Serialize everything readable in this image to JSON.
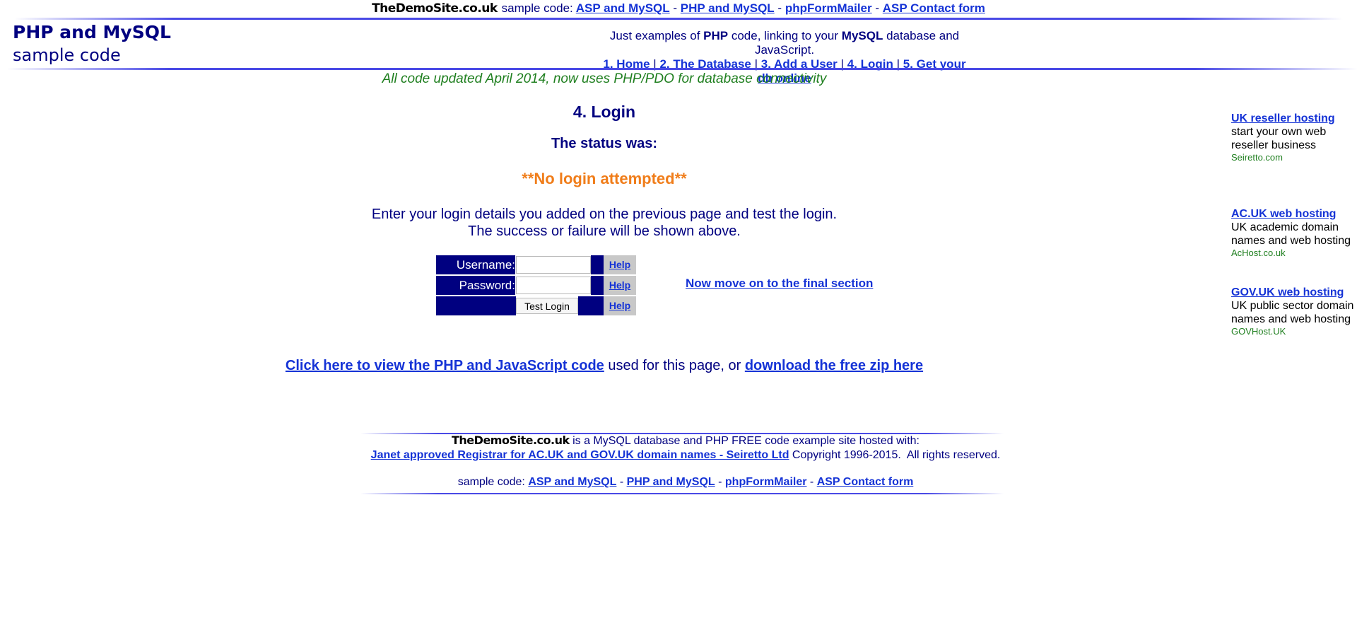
{
  "topbar": {
    "brand": "TheDemoSite.co.uk",
    "label": "sample code:",
    "links": [
      "ASP and MySQL",
      "PHP and MySQL",
      "phpFormMailer",
      "ASP Contact form"
    ],
    "separator": "-"
  },
  "header": {
    "title_line1": "PHP and MySQL",
    "title_line2": "sample code",
    "tagline_part1": "Just examples of ",
    "tagline_php": "PHP",
    "tagline_part2": " code, linking to your ",
    "tagline_mysql": "MySQL",
    "tagline_part3": " database and JavaScript.",
    "nav": [
      "1. Home",
      "2. The Database",
      "3. Add a User",
      "4. Login",
      "5. Get your db online"
    ],
    "nav_separator": "|"
  },
  "notice": "All code updated April 2014, now uses PHP/PDO for database connectivity",
  "main": {
    "heading": "4. Login",
    "status_label": "The status was:",
    "status_value": "**No login attempted**",
    "instructions_line1": "Enter your login details you added on the previous page and test the login.",
    "instructions_line2": "The success or failure will be shown above.",
    "form": {
      "username_label": "Username:",
      "password_label": "Password:",
      "username_value": "",
      "password_value": "",
      "submit_label": "Test Login",
      "help_label": "Help"
    },
    "next_link": "Now move on to the final section",
    "code_link": "Click here to view the PHP and JavaScript code",
    "code_middle": " used for this page, or ",
    "zip_link": "download the free zip here"
  },
  "footer": {
    "brand": "TheDemoSite.co.uk",
    "hosted_text": " is a MySQL database and PHP FREE code example site hosted with:",
    "registrar_link": "Janet approved Registrar for AC.UK and GOV.UK domain names - Seiretto Ltd",
    "copyright": " Copyright 1996-2015.  All rights reserved.",
    "label": "sample code:",
    "links": [
      "ASP and MySQL",
      "PHP and MySQL",
      "phpFormMailer",
      "ASP Contact form"
    ],
    "separator": "-"
  },
  "sidebar": {
    "ads": [
      {
        "title": "UK reseller hosting",
        "desc": "start your own web reseller business",
        "source": "Seiretto.com"
      },
      {
        "title": "AC.UK web hosting",
        "desc": "UK academic domain names and web hosting",
        "source": "AcHost.co.uk"
      },
      {
        "title": "GOV.UK web hosting",
        "desc": "UK public sector domain names and web hosting",
        "source": "GOVHost.UK"
      }
    ]
  },
  "colors": {
    "navy": "#000080",
    "link": "#1533d6",
    "status_orange": "#f07d1a",
    "notice_green": "#1f7f1f",
    "help_gray": "#c8c8c8"
  }
}
